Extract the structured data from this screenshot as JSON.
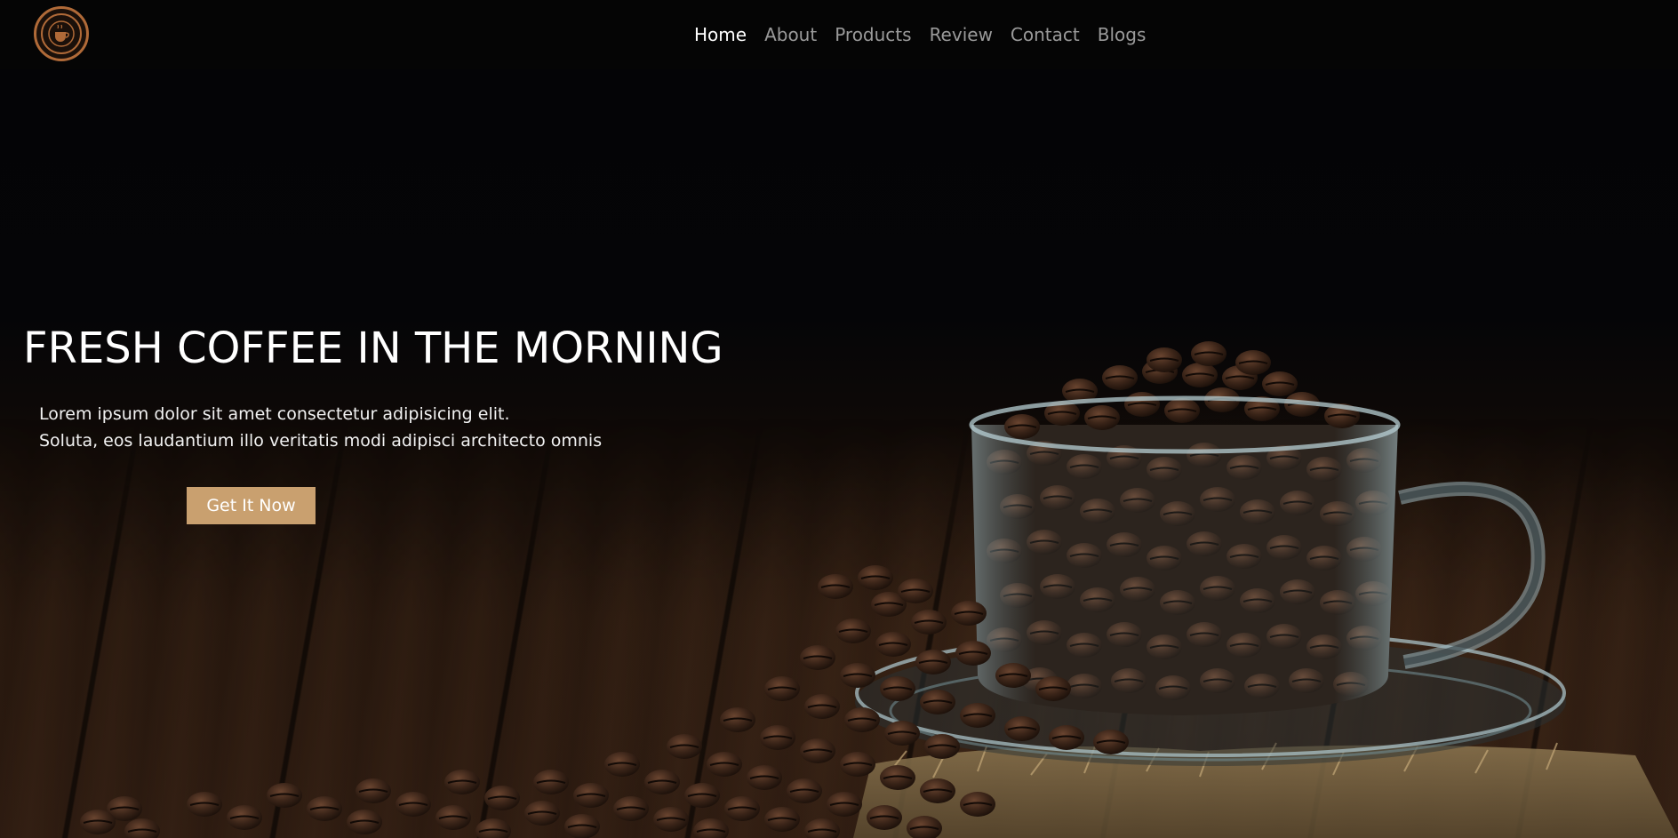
{
  "nav": {
    "logo_alt": "Coffee shop logo",
    "links": [
      {
        "label": "Home",
        "active": true
      },
      {
        "label": "About",
        "active": false
      },
      {
        "label": "Products",
        "active": false
      },
      {
        "label": "Review",
        "active": false
      },
      {
        "label": "Contact",
        "active": false
      },
      {
        "label": "Blogs",
        "active": false
      }
    ]
  },
  "hero": {
    "title": "FRESH COFFEE IN THE MORNING",
    "text_line_1": "Lorem ipsum dolor sit amet consectetur adipisicing elit.",
    "text_line_2": "Soluta, eos laudantium illo veritatis modi adipisci architecto omnis",
    "button_label": "Get It Now"
  },
  "colors": {
    "accent": "#c9a06f",
    "background": "#050507",
    "logo_ring": "#b06a38",
    "nav_active": "#ffffff",
    "nav_inactive": "#9a9a9a"
  },
  "icons": {
    "logo": "coffee-cup-badge-icon"
  }
}
